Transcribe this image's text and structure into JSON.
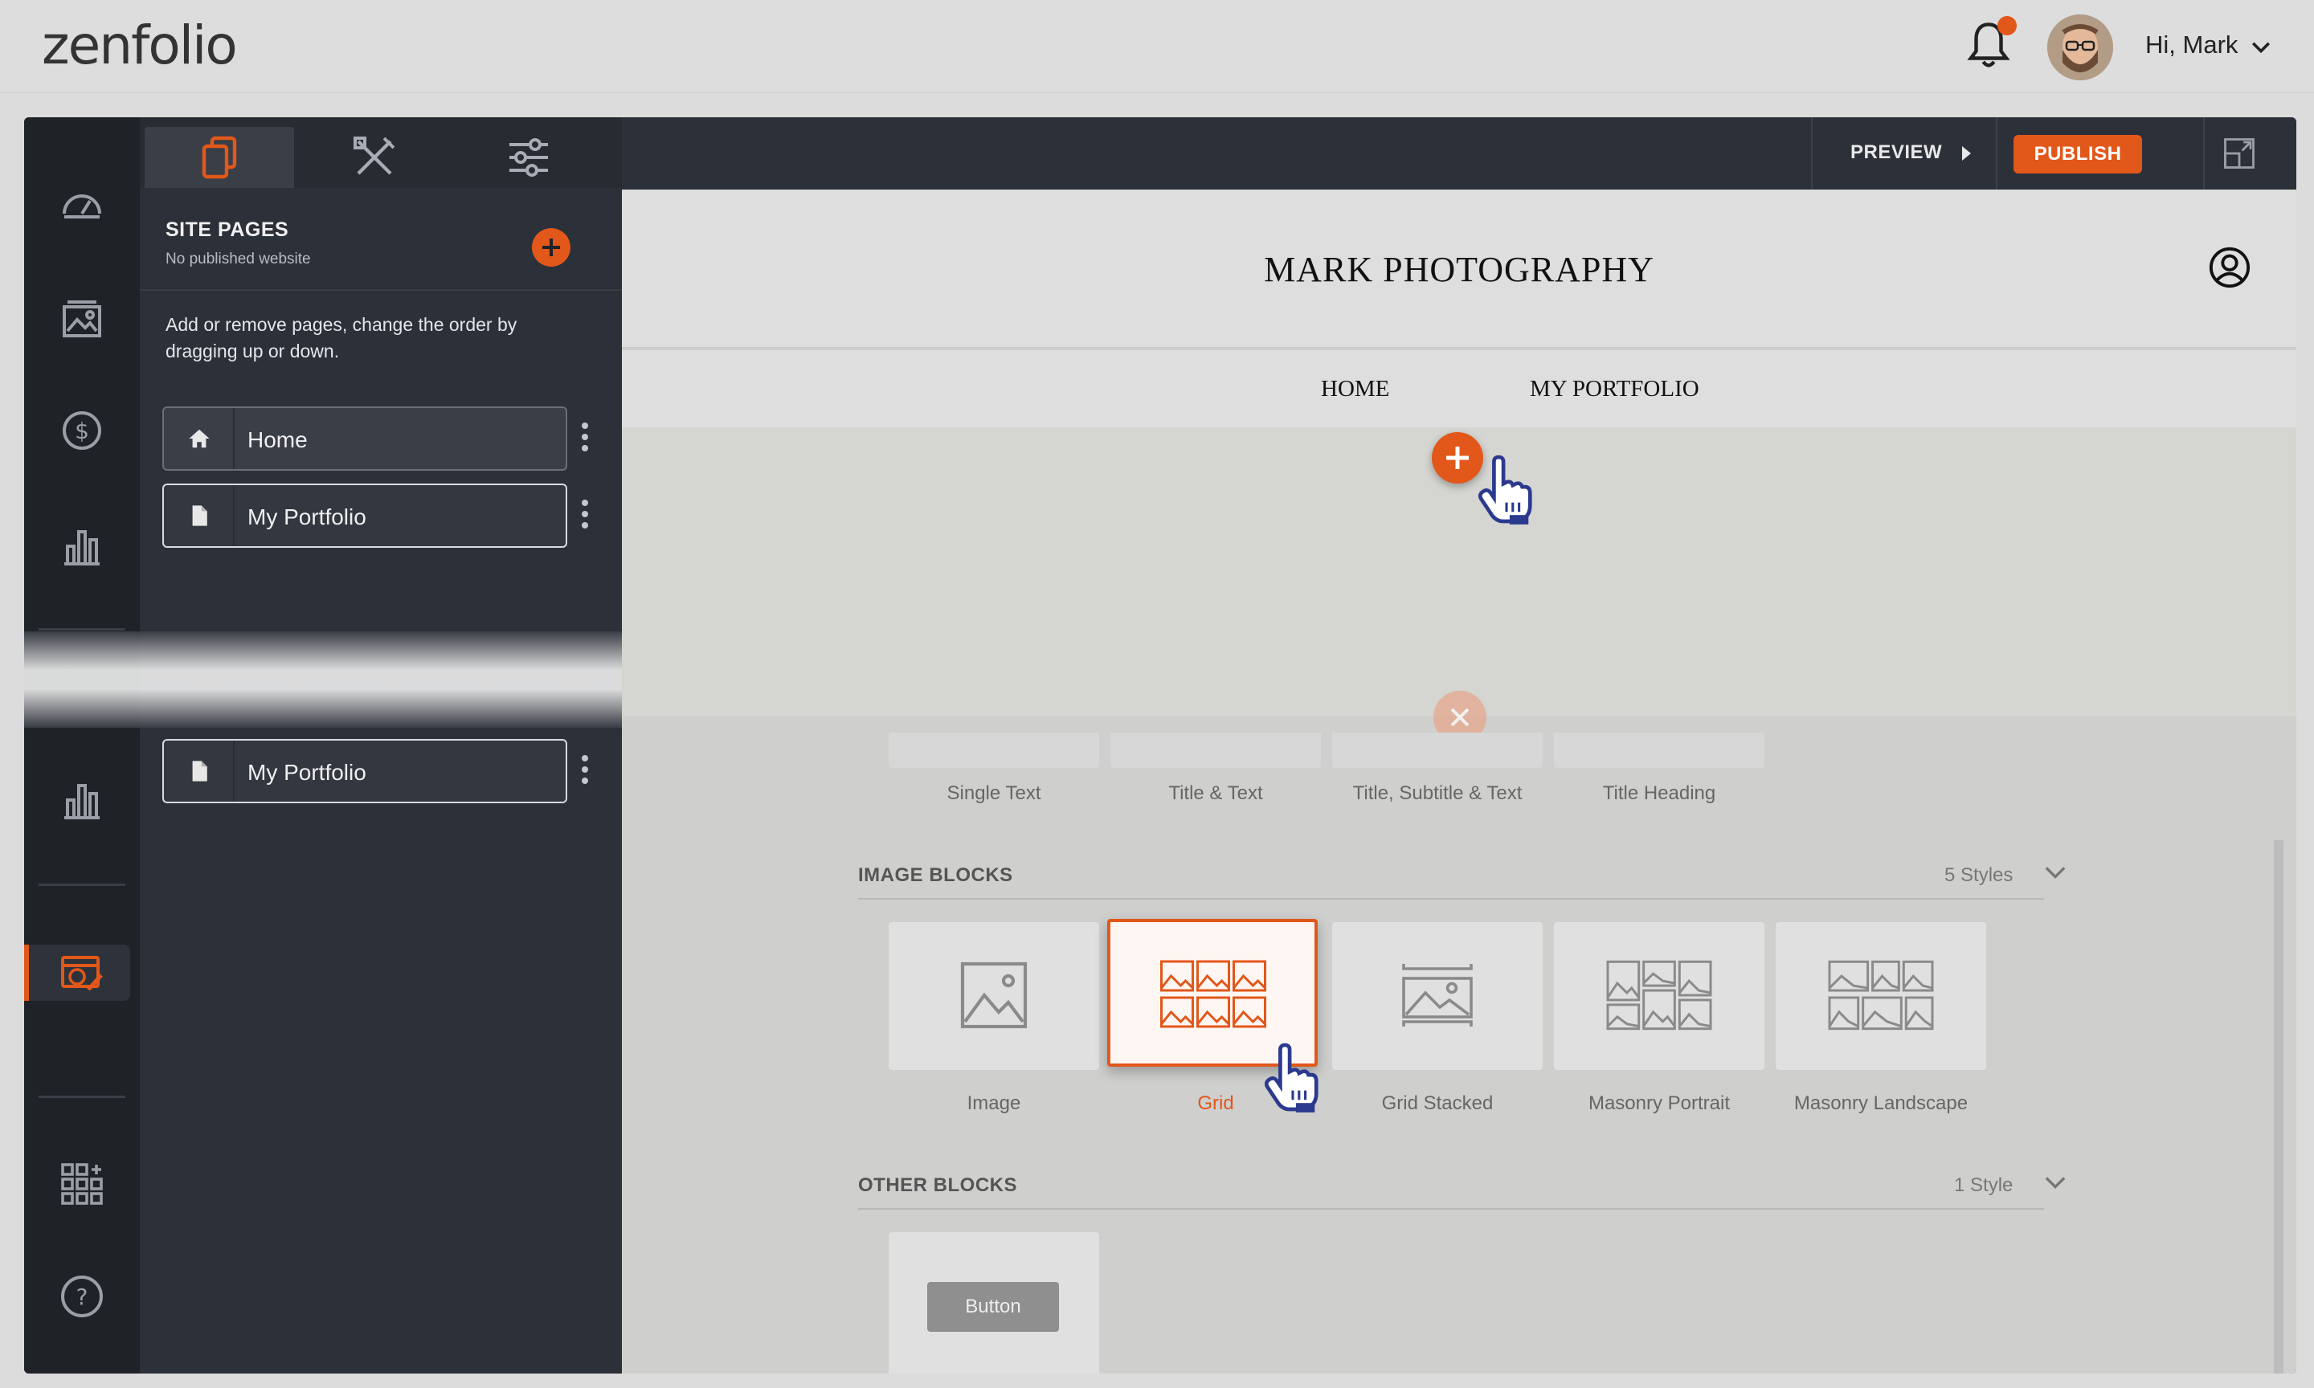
{
  "app": {
    "logo": "zenfolio",
    "greeting": "Hi, Mark"
  },
  "colors": {
    "accent": "#e2571a",
    "dark_panel": "#2c3038",
    "rail": "#1f2227"
  },
  "panel": {
    "title": "SITE PAGES",
    "subtitle": "No published website",
    "description": "Add or remove pages, change the order by dragging up or down.",
    "pages": [
      {
        "label": "Home",
        "icon": "home-icon"
      },
      {
        "label": "My Portfolio",
        "icon": "page-icon"
      }
    ],
    "duplicate_page": {
      "label": "My Portfolio"
    }
  },
  "toolbar": {
    "preview_label": "PREVIEW",
    "publish_label": "PUBLISH"
  },
  "site": {
    "title": "MARK PHOTOGRAPHY",
    "nav": [
      "HOME",
      "MY PORTFOLIO"
    ]
  },
  "text_blocks": {
    "labels": [
      "Single Text",
      "Title & Text",
      "Title, Subtitle & Text",
      "Title Heading"
    ]
  },
  "image_blocks": {
    "title": "IMAGE BLOCKS",
    "count": "5 Styles",
    "items": [
      "Image",
      "Grid",
      "Grid Stacked",
      "Masonry Portrait",
      "Masonry Landscape"
    ],
    "selected": "Grid"
  },
  "other_blocks": {
    "title": "OTHER BLOCKS",
    "count": "1 Style",
    "button_label": "Button"
  }
}
